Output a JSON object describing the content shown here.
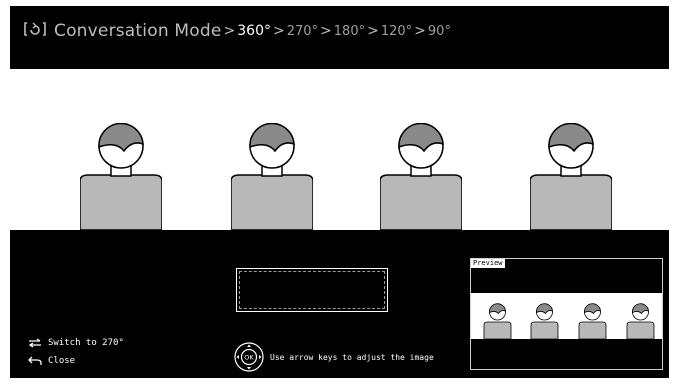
{
  "header": {
    "mode_label": "Conversation Mode",
    "separator": ">",
    "angles": [
      {
        "label": "360°",
        "active": true
      },
      {
        "label": "270°",
        "active": false
      },
      {
        "label": "180°",
        "active": false
      },
      {
        "label": "120°",
        "active": false
      },
      {
        "label": "90°",
        "active": false
      }
    ]
  },
  "controls": {
    "switch_label": "Switch to 270°",
    "close_label": "Close"
  },
  "help": {
    "text": "Use arrow keys to adjust the image",
    "button_label": "OK"
  },
  "preview": {
    "label": "Preview"
  },
  "colors": {
    "background": "#ffffff",
    "panel": "#000000",
    "hair": "#8a8a8a",
    "body": "#b8b8b8",
    "active_text": "#ffffff",
    "inactive_text": "#bdbdbd"
  }
}
